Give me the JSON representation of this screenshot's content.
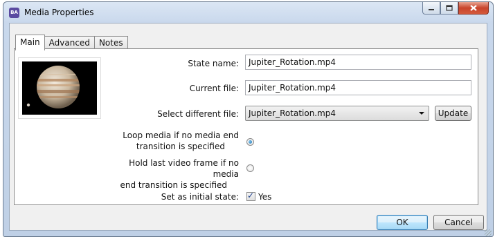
{
  "window": {
    "app_icon_text": "BA",
    "title": "Media Properties",
    "minimize_icon": "minimize-icon",
    "maximize_icon": "maximize-icon",
    "close_icon": "close-icon"
  },
  "tabs": [
    {
      "label": "Main",
      "active": true
    },
    {
      "label": "Advanced",
      "active": false
    },
    {
      "label": "Notes",
      "active": false
    }
  ],
  "main": {
    "state_name_label": "State name:",
    "state_name_value": "Jupiter_Rotation.mp4",
    "current_file_label": "Current file:",
    "current_file_value": "Jupiter_Rotation.mp4",
    "select_file_label": "Select different file:",
    "select_file_value": "Jupiter_Rotation.mp4",
    "update_label": "Update",
    "loop_label_1": "Loop media if no media end",
    "loop_label_2": "transition is specified",
    "loop_checked": true,
    "hold_label_1": "Hold last video frame if no media",
    "hold_label_2": "end transition is specified",
    "hold_checked": false,
    "initial_state_label": "Set as initial state:",
    "initial_state_checked": true,
    "initial_state_value": "Yes"
  },
  "footer": {
    "ok_label": "OK",
    "cancel_label": "Cancel"
  },
  "colors": {
    "titlebar": "#c9d8ec",
    "close_button": "#c8442b",
    "default_button_border": "#3c7fb1"
  }
}
